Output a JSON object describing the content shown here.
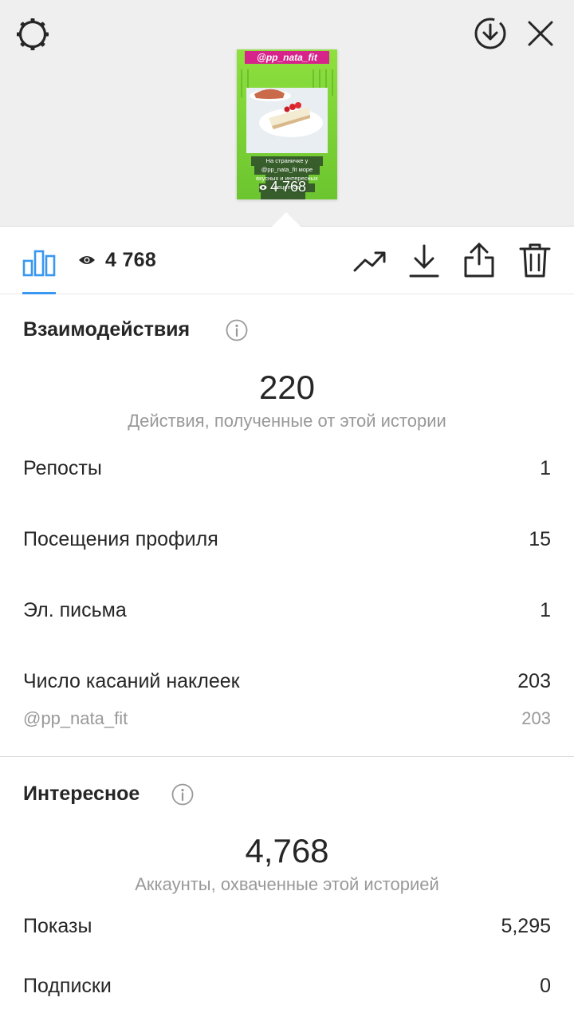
{
  "preview": {
    "sticker_handle": "@pp_nata_fit",
    "caption_text": "На страничке у @pp_nata_fit море вкусных и интересных рецептов",
    "view_overlay": "4 768"
  },
  "toolbar": {
    "views": "4 768"
  },
  "interactions": {
    "title": "Взаимодействия",
    "total": "220",
    "caption": "Действия, полученные от этой истории",
    "rows": [
      {
        "label": "Репосты",
        "value": "1"
      },
      {
        "label": "Посещения профиля",
        "value": "15"
      },
      {
        "label": "Эл. письма",
        "value": "1"
      },
      {
        "label": "Число касаний наклеек",
        "value": "203"
      }
    ],
    "sticker_row": {
      "label": "@pp_nata_fit",
      "value": "203"
    }
  },
  "discovery": {
    "title": "Интересное",
    "total": "4,768",
    "caption": "Аккаунты, охваченные этой историей",
    "rows": [
      {
        "label": "Показы",
        "value": "5,295"
      },
      {
        "label": "Подписки",
        "value": "0"
      }
    ]
  },
  "colors": {
    "accent": "#3897f0",
    "text": "#262626",
    "secondary": "#999999",
    "top_bg": "#efefef",
    "sticker_bg": "#d6248a",
    "story_bg": "#7dd63c"
  }
}
